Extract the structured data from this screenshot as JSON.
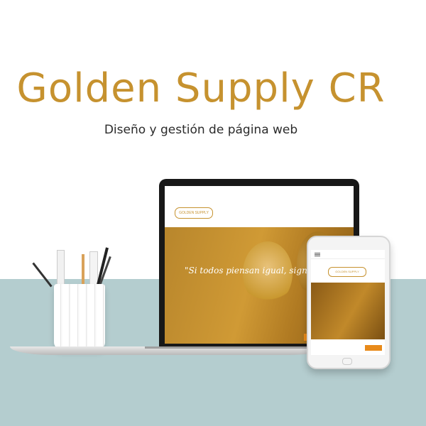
{
  "title": "Golden Supply CR",
  "subtitle": "Diseño y gestión de página web",
  "laptop_site": {
    "topbar_text": "",
    "logo_text": "GOLDEN SUPPLY",
    "nav": [
      "",
      "",
      "",
      "",
      "",
      ""
    ],
    "quote": "\"Si todos piensan igual, significa que",
    "quote_subtext": "",
    "button_label": ""
  },
  "phone_site": {
    "header_text": "",
    "logo_text": "GOLDEN SUPPLY",
    "quote": "",
    "button_label": ""
  },
  "colors": {
    "brand_gold": "#c6922f",
    "floor": "#b4cdcf",
    "accent_orange": "#e88a1a"
  }
}
